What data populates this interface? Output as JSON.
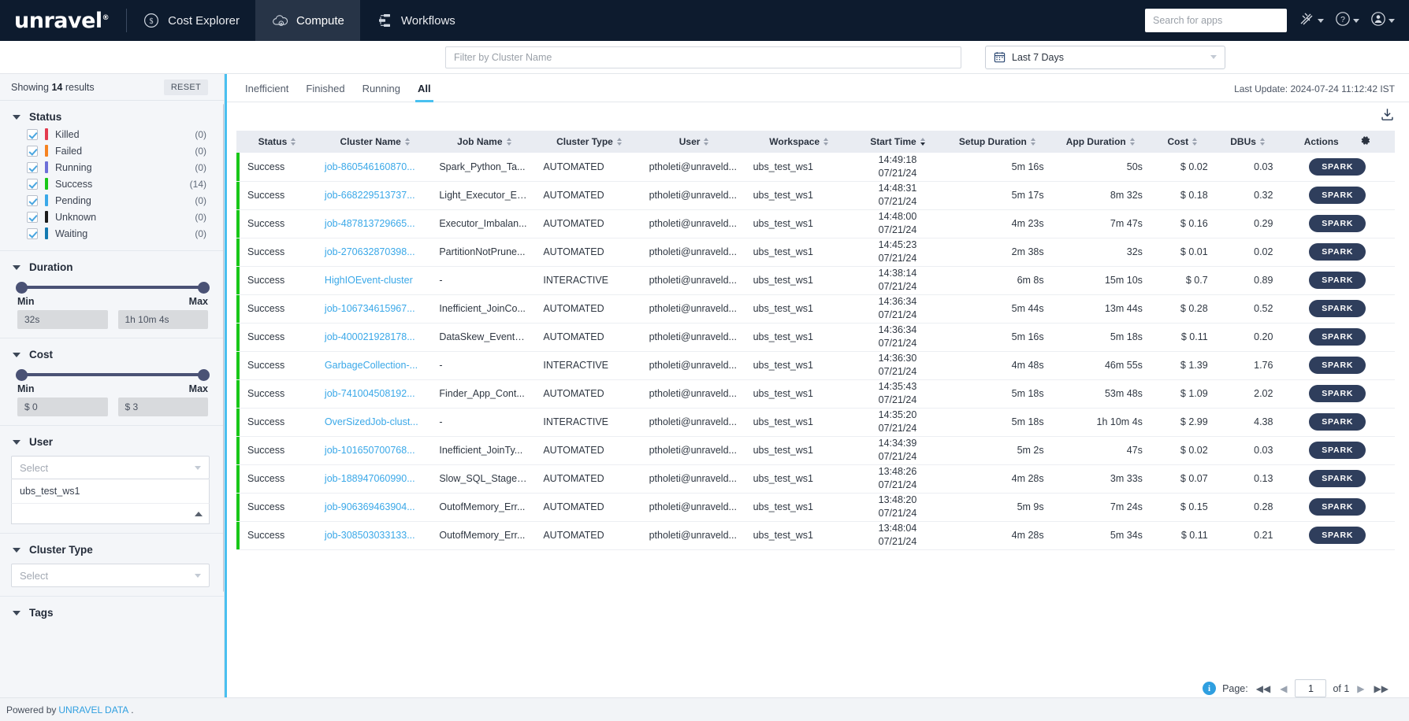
{
  "topnav": {
    "logo": "unravel",
    "items": [
      {
        "label": "Cost Explorer",
        "icon": "dollar-circle-icon",
        "active": false
      },
      {
        "label": "Compute",
        "icon": "cloud-compute-icon",
        "active": true
      },
      {
        "label": "Workflows",
        "icon": "workflow-icon",
        "active": false
      }
    ],
    "search_placeholder": "Search for apps",
    "search_value": "",
    "right_icons": [
      "pipelines-icon",
      "help-icon",
      "user-icon"
    ]
  },
  "filterbar": {
    "cluster_placeholder": "Filter by Cluster Name",
    "cluster_value": "",
    "daterange_label": "Last 7 Days"
  },
  "sidebar": {
    "showing_prefix": "Showing",
    "showing_count": "14",
    "showing_suffix": "results",
    "reset_label": "RESET",
    "status": {
      "title": "Status",
      "items": [
        {
          "label": "Killed",
          "count": "(0)",
          "color": "#e33a4e",
          "checked": true
        },
        {
          "label": "Failed",
          "count": "(0)",
          "color": "#f58220",
          "checked": true
        },
        {
          "label": "Running",
          "count": "(0)",
          "color": "#6d6fd8",
          "checked": true
        },
        {
          "label": "Success",
          "count": "(14)",
          "color": "#18c718",
          "checked": true
        },
        {
          "label": "Pending",
          "count": "(0)",
          "color": "#3aa8e8",
          "checked": true
        },
        {
          "label": "Unknown",
          "count": "(0)",
          "color": "#1c1c1c",
          "checked": true
        },
        {
          "label": "Waiting",
          "count": "(0)",
          "color": "#1379b0",
          "checked": true
        }
      ]
    },
    "duration": {
      "title": "Duration",
      "min_label": "Min",
      "max_label": "Max",
      "min_value": "32s",
      "max_value": "1h 10m 4s"
    },
    "cost": {
      "title": "Cost",
      "min_label": "Min",
      "max_label": "Max",
      "min_value": "$ 0",
      "max_value": "$ 3"
    },
    "user": {
      "title": "User",
      "select_placeholder": "Select",
      "options": [
        "ubs_test_ws1"
      ]
    },
    "cluster_type": {
      "title": "Cluster Type",
      "select_placeholder": "Select"
    },
    "tags": {
      "title": "Tags"
    }
  },
  "main": {
    "tabs": [
      {
        "label": "Inefficient",
        "active": false
      },
      {
        "label": "Finished",
        "active": false
      },
      {
        "label": "Running",
        "active": false
      },
      {
        "label": "All",
        "active": true
      }
    ],
    "last_update": "Last Update: 2024-07-24 11:12:42 IST",
    "download_icon": "download-icon",
    "settings_icon": "gear-icon",
    "columns": [
      {
        "label": "Status",
        "sorted": false
      },
      {
        "label": "Cluster Name",
        "sorted": false
      },
      {
        "label": "Job Name",
        "sorted": false
      },
      {
        "label": "Cluster Type",
        "sorted": false
      },
      {
        "label": "User",
        "sorted": false
      },
      {
        "label": "Workspace",
        "sorted": false
      },
      {
        "label": "Start Time",
        "sorted": true
      },
      {
        "label": "Setup Duration",
        "sorted": false
      },
      {
        "label": "App Duration",
        "sorted": false
      },
      {
        "label": "Cost",
        "sorted": false
      },
      {
        "label": "DBUs",
        "sorted": false
      },
      {
        "label": "Actions",
        "sorted": false
      }
    ],
    "action_label": "SPARK",
    "rows": [
      {
        "status": "Success",
        "status_color": "#18c718",
        "cluster_name": "job-860546160870...",
        "job_name": "Spark_Python_Ta...",
        "cluster_type": "AUTOMATED",
        "user": "ptholeti@unraveld...",
        "workspace": "ubs_test_ws1",
        "start_time": "14:49:18",
        "start_date": "07/21/24",
        "setup_duration": "5m 16s",
        "app_duration": "50s",
        "cost": "$ 0.02",
        "dbus": "0.03"
      },
      {
        "status": "Success",
        "status_color": "#18c718",
        "cluster_name": "job-668229513737...",
        "job_name": "Light_Executor_Ev...",
        "cluster_type": "AUTOMATED",
        "user": "ptholeti@unraveld...",
        "workspace": "ubs_test_ws1",
        "start_time": "14:48:31",
        "start_date": "07/21/24",
        "setup_duration": "5m 17s",
        "app_duration": "8m 32s",
        "cost": "$ 0.18",
        "dbus": "0.32"
      },
      {
        "status": "Success",
        "status_color": "#18c718",
        "cluster_name": "job-487813729665...",
        "job_name": "Executor_Imbalan...",
        "cluster_type": "AUTOMATED",
        "user": "ptholeti@unraveld...",
        "workspace": "ubs_test_ws1",
        "start_time": "14:48:00",
        "start_date": "07/21/24",
        "setup_duration": "4m 23s",
        "app_duration": "7m 47s",
        "cost": "$ 0.16",
        "dbus": "0.29"
      },
      {
        "status": "Success",
        "status_color": "#18c718",
        "cluster_name": "job-270632870398...",
        "job_name": "PartitionNotPrune...",
        "cluster_type": "AUTOMATED",
        "user": "ptholeti@unraveld...",
        "workspace": "ubs_test_ws1",
        "start_time": "14:45:23",
        "start_date": "07/21/24",
        "setup_duration": "2m 38s",
        "app_duration": "32s",
        "cost": "$ 0.01",
        "dbus": "0.02"
      },
      {
        "status": "Success",
        "status_color": "#18c718",
        "cluster_name": "HighIOEvent-cluster",
        "job_name": "-",
        "cluster_type": "INTERACTIVE",
        "user": "ptholeti@unraveld...",
        "workspace": "ubs_test_ws1",
        "start_time": "14:38:14",
        "start_date": "07/21/24",
        "setup_duration": "6m 8s",
        "app_duration": "15m 10s",
        "cost": "$ 0.7",
        "dbus": "0.89"
      },
      {
        "status": "Success",
        "status_color": "#18c718",
        "cluster_name": "job-106734615967...",
        "job_name": "Inefficient_JoinCo...",
        "cluster_type": "AUTOMATED",
        "user": "ptholeti@unraveld...",
        "workspace": "ubs_test_ws1",
        "start_time": "14:36:34",
        "start_date": "07/21/24",
        "setup_duration": "5m 44s",
        "app_duration": "13m 44s",
        "cost": "$ 0.28",
        "dbus": "0.52"
      },
      {
        "status": "Success",
        "status_color": "#18c718",
        "cluster_name": "job-400021928178...",
        "job_name": "DataSkew_EventG...",
        "cluster_type": "AUTOMATED",
        "user": "ptholeti@unraveld...",
        "workspace": "ubs_test_ws1",
        "start_time": "14:36:34",
        "start_date": "07/21/24",
        "setup_duration": "5m 16s",
        "app_duration": "5m 18s",
        "cost": "$ 0.11",
        "dbus": "0.20"
      },
      {
        "status": "Success",
        "status_color": "#18c718",
        "cluster_name": "GarbageCollection-...",
        "job_name": "-",
        "cluster_type": "INTERACTIVE",
        "user": "ptholeti@unraveld...",
        "workspace": "ubs_test_ws1",
        "start_time": "14:36:30",
        "start_date": "07/21/24",
        "setup_duration": "4m 48s",
        "app_duration": "46m 55s",
        "cost": "$ 1.39",
        "dbus": "1.76"
      },
      {
        "status": "Success",
        "status_color": "#18c718",
        "cluster_name": "job-741004508192...",
        "job_name": "Finder_App_Cont...",
        "cluster_type": "AUTOMATED",
        "user": "ptholeti@unraveld...",
        "workspace": "ubs_test_ws1",
        "start_time": "14:35:43",
        "start_date": "07/21/24",
        "setup_duration": "5m 18s",
        "app_duration": "53m 48s",
        "cost": "$ 1.09",
        "dbus": "2.02"
      },
      {
        "status": "Success",
        "status_color": "#18c718",
        "cluster_name": "OverSizedJob-clust...",
        "job_name": "-",
        "cluster_type": "INTERACTIVE",
        "user": "ptholeti@unraveld...",
        "workspace": "ubs_test_ws1",
        "start_time": "14:35:20",
        "start_date": "07/21/24",
        "setup_duration": "5m 18s",
        "app_duration": "1h 10m 4s",
        "cost": "$ 2.99",
        "dbus": "4.38"
      },
      {
        "status": "Success",
        "status_color": "#18c718",
        "cluster_name": "job-101650700768...",
        "job_name": "Inefficient_JoinTy...",
        "cluster_type": "AUTOMATED",
        "user": "ptholeti@unraveld...",
        "workspace": "ubs_test_ws1",
        "start_time": "14:34:39",
        "start_date": "07/21/24",
        "setup_duration": "5m 2s",
        "app_duration": "47s",
        "cost": "$ 0.02",
        "dbus": "0.03"
      },
      {
        "status": "Success",
        "status_color": "#18c718",
        "cluster_name": "job-188947060990...",
        "job_name": "Slow_SQL_Stage_...",
        "cluster_type": "AUTOMATED",
        "user": "ptholeti@unraveld...",
        "workspace": "ubs_test_ws1",
        "start_time": "13:48:26",
        "start_date": "07/21/24",
        "setup_duration": "4m 28s",
        "app_duration": "3m 33s",
        "cost": "$ 0.07",
        "dbus": "0.13"
      },
      {
        "status": "Success",
        "status_color": "#18c718",
        "cluster_name": "job-906369463904...",
        "job_name": "OutofMemory_Err...",
        "cluster_type": "AUTOMATED",
        "user": "ptholeti@unraveld...",
        "workspace": "ubs_test_ws1",
        "start_time": "13:48:20",
        "start_date": "07/21/24",
        "setup_duration": "5m 9s",
        "app_duration": "7m 24s",
        "cost": "$ 0.15",
        "dbus": "0.28"
      },
      {
        "status": "Success",
        "status_color": "#18c718",
        "cluster_name": "job-308503033133...",
        "job_name": "OutofMemory_Err...",
        "cluster_type": "AUTOMATED",
        "user": "ptholeti@unraveld...",
        "workspace": "ubs_test_ws1",
        "start_time": "13:48:04",
        "start_date": "07/21/24",
        "setup_duration": "4m 28s",
        "app_duration": "5m 34s",
        "cost": "$ 0.11",
        "dbus": "0.21"
      }
    ],
    "pager": {
      "page_label": "Page:",
      "page_value": "1",
      "of_label": "of 1",
      "first": "◀◀",
      "prev": "◀",
      "next": "▶",
      "last": "▶▶"
    }
  },
  "footer": {
    "prefix": "Powered by",
    "link": "UNRAVEL DATA",
    "suffix": "."
  }
}
